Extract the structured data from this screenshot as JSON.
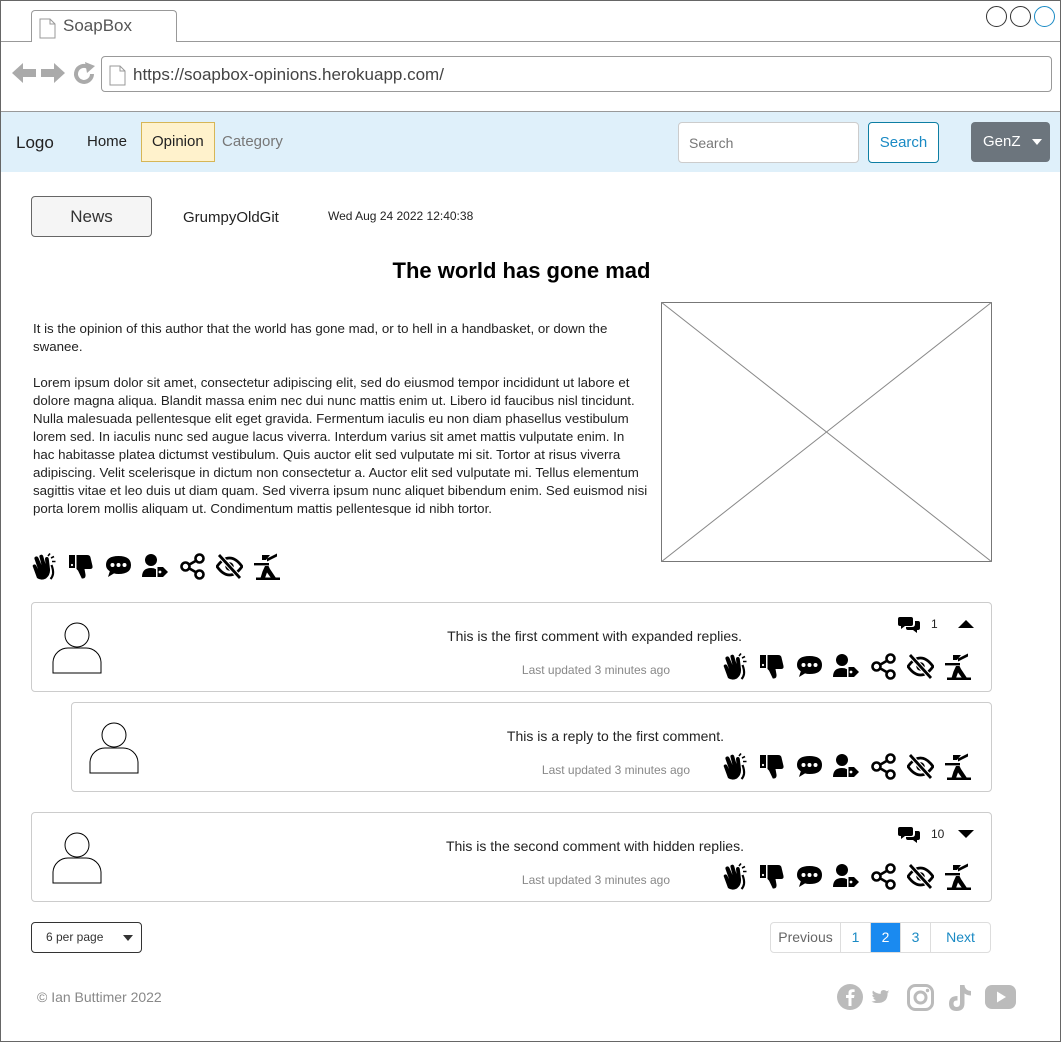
{
  "browser": {
    "tab_title": "SoapBox",
    "url": "https://soapbox-opinions.herokuapp.com/"
  },
  "navbar": {
    "logo": "Logo",
    "links": {
      "home": "Home",
      "opinion": "Opinion",
      "category": "Category"
    },
    "search_placeholder": "Search",
    "search_button": "Search",
    "user_menu": "GenZ"
  },
  "article": {
    "category_button": "News",
    "author": "GrumpyOldGit",
    "date": "Wed Aug 24 2022 12:40:38",
    "title": "The world has gone mad",
    "paragraphs": [
      "It is the opinion of this author that the world has gone mad, or to hell in a handbasket, or down the swanee.",
      "Lorem ipsum dolor sit amet, consectetur adipiscing elit, sed do eiusmod tempor incididunt ut labore et dolore magna aliqua. Blandit massa enim nec dui nunc mattis enim ut. Libero id faucibus nisl tincidunt. Nulla malesuada pellentesque elit eget gravida. Fermentum iaculis eu non diam phasellus vestibulum lorem sed. In iaculis nunc sed augue lacus viverra. Interdum varius sit amet mattis vulputate enim. In hac habitasse platea dictumst vestibulum. Quis auctor elit sed vulputate mi sit. Tortor at risus viverra adipiscing. Velit scelerisque in dictum non consectetur a. Auctor elit sed vulputate mi. Tellus elementum sagittis vitae et leo duis ut diam quam. Sed viverra ipsum nunc aliquet bibendum enim. Sed euismod nisi porta lorem mollis aliquam ut. Condimentum mattis pellentesque id nibh tortor."
    ],
    "actions": [
      "clap-icon",
      "thumbs-down-icon",
      "comment-icon",
      "user-tag-icon",
      "share-icon",
      "hide-icon",
      "report-icon"
    ]
  },
  "comments": [
    {
      "text": "This is the first comment with expanded replies.",
      "updated": "Last updated 3 minutes ago",
      "reply_count": "1",
      "replies_expanded": true
    },
    {
      "text": "This is a reply to the first comment.",
      "updated": "Last updated 3 minutes ago",
      "is_reply": true
    },
    {
      "text": "This is the second comment with hidden replies.",
      "updated": "Last updated 3 minutes ago",
      "reply_count": "10",
      "replies_expanded": false
    }
  ],
  "pagination": {
    "per_page": "6 per page",
    "previous": "Previous",
    "pages": [
      "1",
      "2",
      "3"
    ],
    "current_page": "2",
    "next": "Next"
  },
  "footer": {
    "copyright": "© Ian Buttimer 2022",
    "social": [
      "facebook-icon",
      "twitter-icon",
      "instagram-icon",
      "tiktok-icon",
      "youtube-icon"
    ]
  },
  "colors": {
    "navbar_bg": "#dff0fa",
    "active_nav_bg": "#fff2cc",
    "primary": "#1a8af0",
    "user_menu_bg": "#6c757d"
  }
}
